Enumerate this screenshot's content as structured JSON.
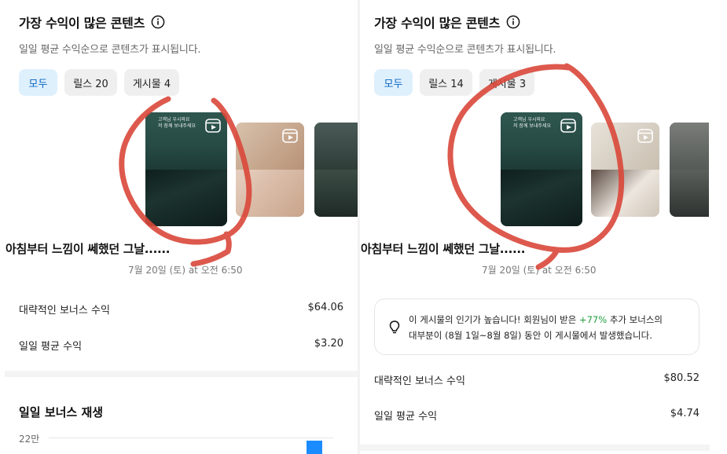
{
  "left": {
    "title": "가장 수익이 많은 콘텐츠",
    "subtitle": "일일 평균 수익순으로 콘텐츠가 표시됩니다.",
    "chips": [
      {
        "label": "모두",
        "active": true
      },
      {
        "label": "릴스 20",
        "active": false
      },
      {
        "label": "게시물 4",
        "active": false
      }
    ],
    "thumb_overlay_text": "고객님 우시와요\n저 잠께 보내주세요",
    "post_title": "아침부터 느낌이 쎄했던 그날......",
    "post_date": "7월 20일 (토) at 오전 6:50",
    "stats": [
      {
        "label": "대략적인 보너스 수익",
        "value": "$64.06"
      },
      {
        "label": "일일 평균 수익",
        "value": "$3.20"
      }
    ],
    "chart_section_title": "일일 보너스 재생",
    "chart_data": {
      "type": "bar",
      "title": "일일 보너스 재생",
      "y_ticks": [
        "22만"
      ],
      "grid": true
    }
  },
  "right": {
    "title": "가장 수익이 많은 콘텐츠",
    "subtitle": "일일 평균 수익순으로 콘텐츠가 표시됩니다.",
    "chips": [
      {
        "label": "모두",
        "active": true
      },
      {
        "label": "릴스 14",
        "active": false
      },
      {
        "label": "게시물 3",
        "active": false
      }
    ],
    "thumb_overlay_text": "고객님 우시와요\n저 잠께 보내주세요",
    "post_title": "아침부터 느낌이 쎄했던 그날......",
    "post_date": "7월 20일 (토) at 오전 6:50",
    "tip": {
      "before_pct": "이 게시물의 인기가 높습니다! 회원님이 받은 ",
      "pct": "+77%",
      "after_pct": " 추가 보너스의",
      "line2": "대부분이 (8월 1일~8월 8일) 동안 이 게시물에서 발생했습니다."
    },
    "stats": [
      {
        "label": "대략적인 보너스 수익",
        "value": "$80.52"
      },
      {
        "label": "일일 평균 수익",
        "value": "$4.74"
      }
    ]
  },
  "colors": {
    "accent_blue": "#1a8cff",
    "chip_active_bg": "#dff0fd",
    "chip_active_text": "#0a66c2",
    "scribble_red": "#d9473a",
    "tip_green": "#1e9e3d"
  }
}
